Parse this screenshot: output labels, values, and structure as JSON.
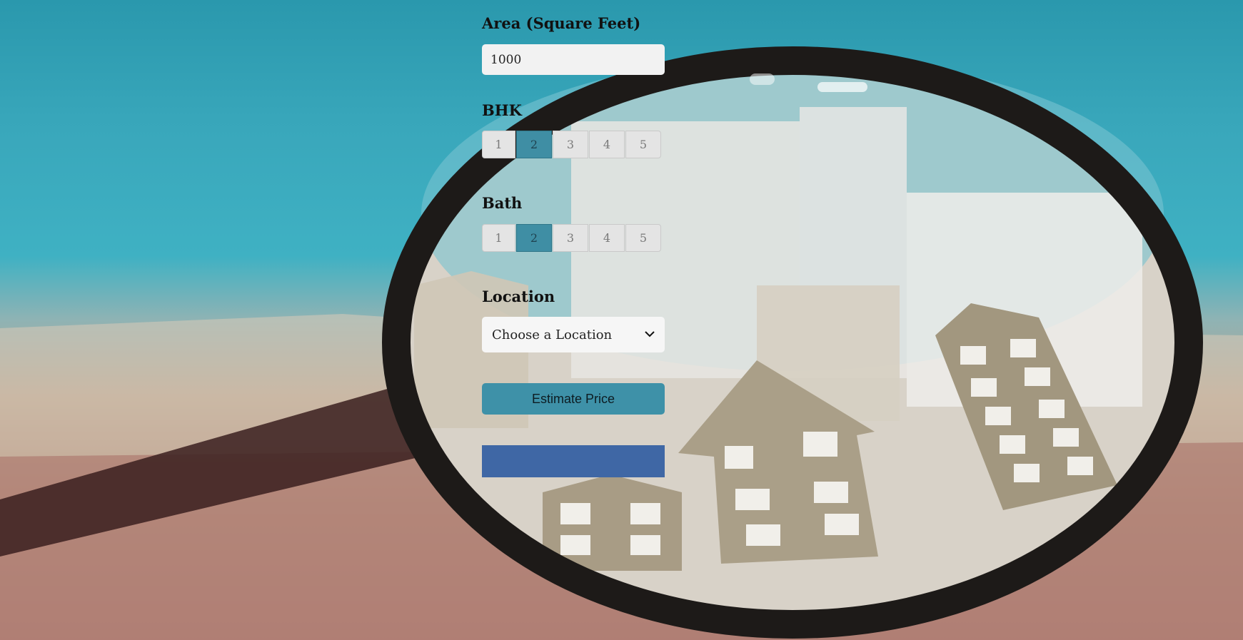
{
  "form": {
    "area_label": "Area (Square Feet)",
    "area_value": "1000",
    "bhk_label": "BHK",
    "bhk_options": [
      "1",
      "2",
      "3",
      "4",
      "5"
    ],
    "bhk_selected": "2",
    "bath_label": "Bath",
    "bath_options": [
      "1",
      "2",
      "3",
      "4",
      "5"
    ],
    "bath_selected": "2",
    "location_label": "Location",
    "location_selected": "Choose a Location",
    "estimate_button": "Estimate Price",
    "result_text": ""
  },
  "colors": {
    "active_segment": "#3f8ea4",
    "estimate_button": "#3e91a8",
    "result_box": "#3f67a5"
  },
  "icons": {
    "location_dropdown": "chevron-down-icon"
  }
}
